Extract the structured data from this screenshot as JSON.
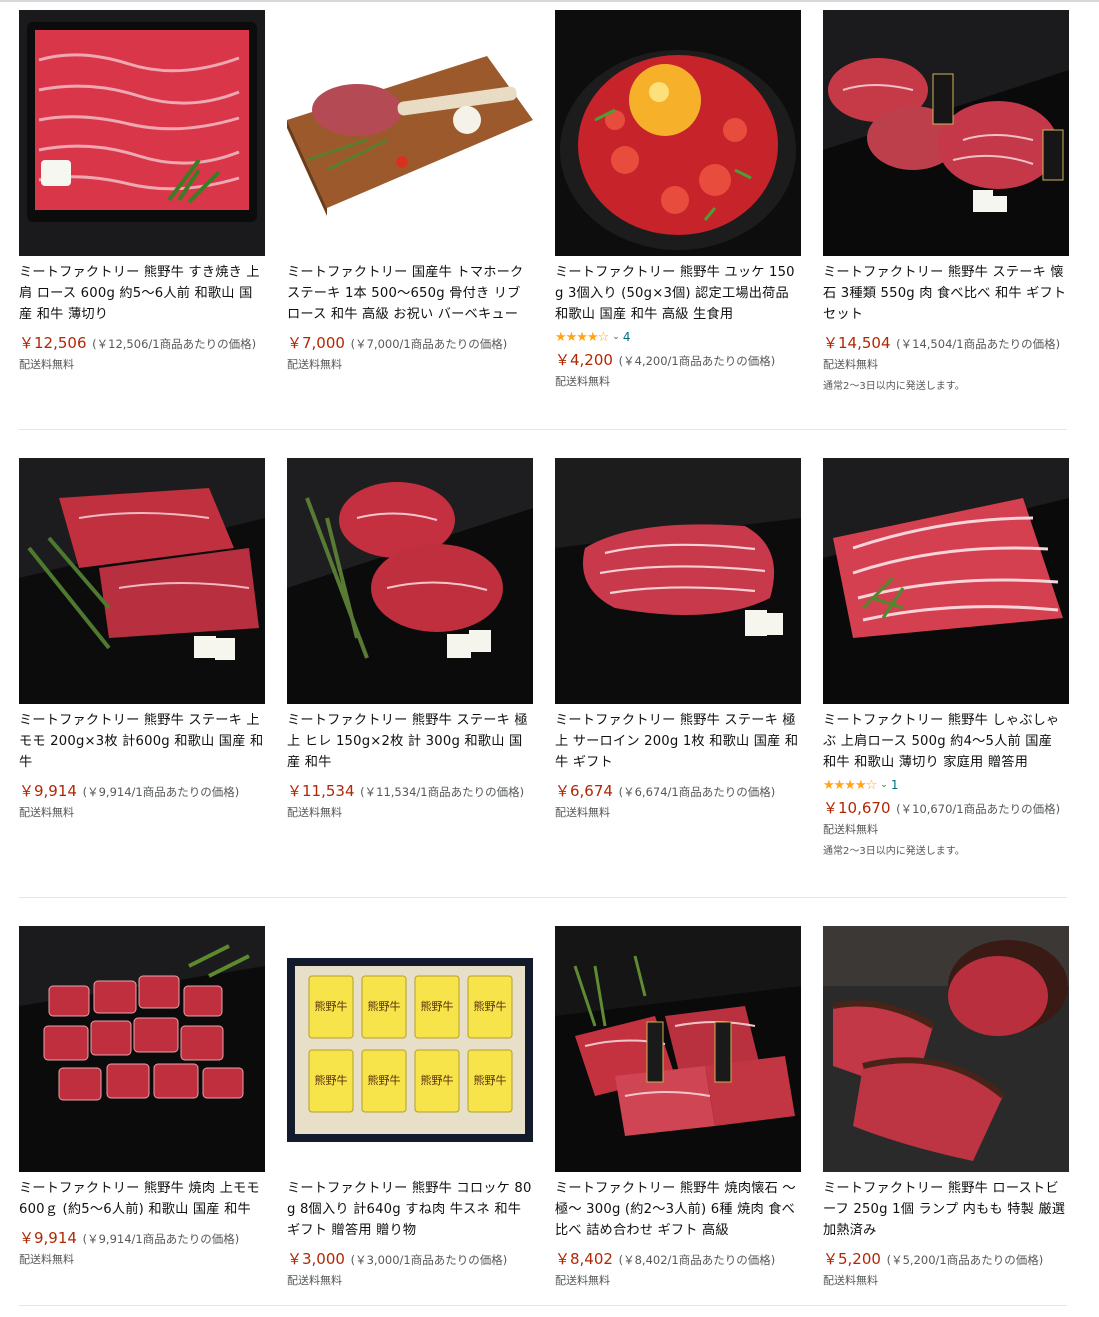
{
  "products": [
    {
      "title": "ミートファクトリー 熊野牛 すき焼き 上肩 ロース 600g 約5〜6人前 和歌山 国産 和牛 薄切り",
      "price": "￥12,506",
      "unit_price": "(￥12,506/1商品あたりの価格)",
      "shipping": "配送料無料",
      "delivery": "",
      "rating": null,
      "rating_count": "",
      "image": "sukiyaki-loin-slices"
    },
    {
      "title": "ミートファクトリー 国産牛 トマホーク ステーキ 1本 500〜650g 骨付き リブロース 和牛 高級 お祝い バーベキュー",
      "price": "￥7,000",
      "unit_price": "(￥7,000/1商品あたりの価格)",
      "shipping": "配送料無料",
      "delivery": "",
      "rating": null,
      "rating_count": "",
      "image": "tomahawk-steak-board"
    },
    {
      "title": "ミートファクトリー 熊野牛 ユッケ 150g 3個入り (50g×3個) 認定工場出荷品 和歌山 国産 和牛 高級 生食用",
      "price": "￥4,200",
      "unit_price": "(￥4,200/1商品あたりの価格)",
      "shipping": "配送料無料",
      "delivery": "",
      "rating": 4,
      "rating_count": "4",
      "image": "yukhoe-egg"
    },
    {
      "title": "ミートファクトリー 熊野牛 ステーキ 懐石 3種類 550g 肉 食べ比べ 和牛 ギフト セット",
      "price": "￥14,504",
      "unit_price": "(￥14,504/1商品あたりの価格)",
      "shipping": "配送料無料",
      "delivery": "通常2〜3日以内に発送します。",
      "rating": null,
      "rating_count": "",
      "image": "steak-kaiseki-three"
    },
    {
      "title": "ミートファクトリー 熊野牛 ステーキ 上モモ 200g×3枚 計600g 和歌山 国産 和牛",
      "price": "￥9,914",
      "unit_price": "(￥9,914/1商品あたりの価格)",
      "shipping": "配送料無料",
      "delivery": "",
      "rating": null,
      "rating_count": "",
      "image": "momo-steak"
    },
    {
      "title": "ミートファクトリー 熊野牛 ステーキ 極上 ヒレ 150g×2枚 計 300g 和歌山 国産 和牛",
      "price": "￥11,534",
      "unit_price": "(￥11,534/1商品あたりの価格)",
      "shipping": "配送料無料",
      "delivery": "",
      "rating": null,
      "rating_count": "",
      "image": "fillet-steak"
    },
    {
      "title": "ミートファクトリー 熊野牛 ステーキ 極上 サーロイン 200g 1枚 和歌山 国産 和牛 ギフト",
      "price": "￥6,674",
      "unit_price": "(￥6,674/1商品あたりの価格)",
      "shipping": "配送料無料",
      "delivery": "",
      "rating": null,
      "rating_count": "",
      "image": "sirloin-steak"
    },
    {
      "title": "ミートファクトリー 熊野牛 しゃぶしゃぶ 上肩ロース 500g 約4〜5人前 国産 和牛 和歌山 薄切り 家庭用 贈答用",
      "price": "￥10,670",
      "unit_price": "(￥10,670/1商品あたりの価格)",
      "shipping": "配送料無料",
      "delivery": "通常2〜3日以内に発送します。",
      "rating": 4,
      "rating_count": "1",
      "image": "shabu-shabu-slices"
    },
    {
      "title": "ミートファクトリー 熊野牛 焼肉 上モモ 600ｇ (約5〜6人前) 和歌山 国産 和牛",
      "price": "￥9,914",
      "unit_price": "(￥9,914/1商品あたりの価格)",
      "shipping": "配送料無料",
      "delivery": "",
      "rating": null,
      "rating_count": "",
      "image": "yakiniku-cubes"
    },
    {
      "title": "ミートファクトリー 熊野牛 コロッケ 80g 8個入り 計640g すね肉 牛スネ 和牛 ギフト 贈答用 贈り物",
      "price": "￥3,000",
      "unit_price": "(￥3,000/1商品あたりの価格)",
      "shipping": "配送料無料",
      "delivery": "",
      "rating": null,
      "rating_count": "",
      "image": "croquette-box",
      "label": "熊野牛"
    },
    {
      "title": "ミートファクトリー 熊野牛 焼肉懐石 〜極〜 300g (約2〜3人前) 6種 焼肉 食べ比べ 詰め合わせ ギフト 高級",
      "price": "￥8,402",
      "unit_price": "(￥8,402/1商品あたりの価格)",
      "shipping": "配送料無料",
      "delivery": "",
      "rating": null,
      "rating_count": "",
      "image": "yakiniku-kaiseki"
    },
    {
      "title": "ミートファクトリー 熊野牛 ローストビーフ 250g 1個 ランプ 内もも 特製 厳選 加熱済み",
      "price": "￥5,200",
      "unit_price": "(￥5,200/1商品あたりの価格)",
      "shipping": "配送料無料",
      "delivery": "",
      "rating": null,
      "rating_count": "",
      "image": "roast-beef"
    }
  ]
}
